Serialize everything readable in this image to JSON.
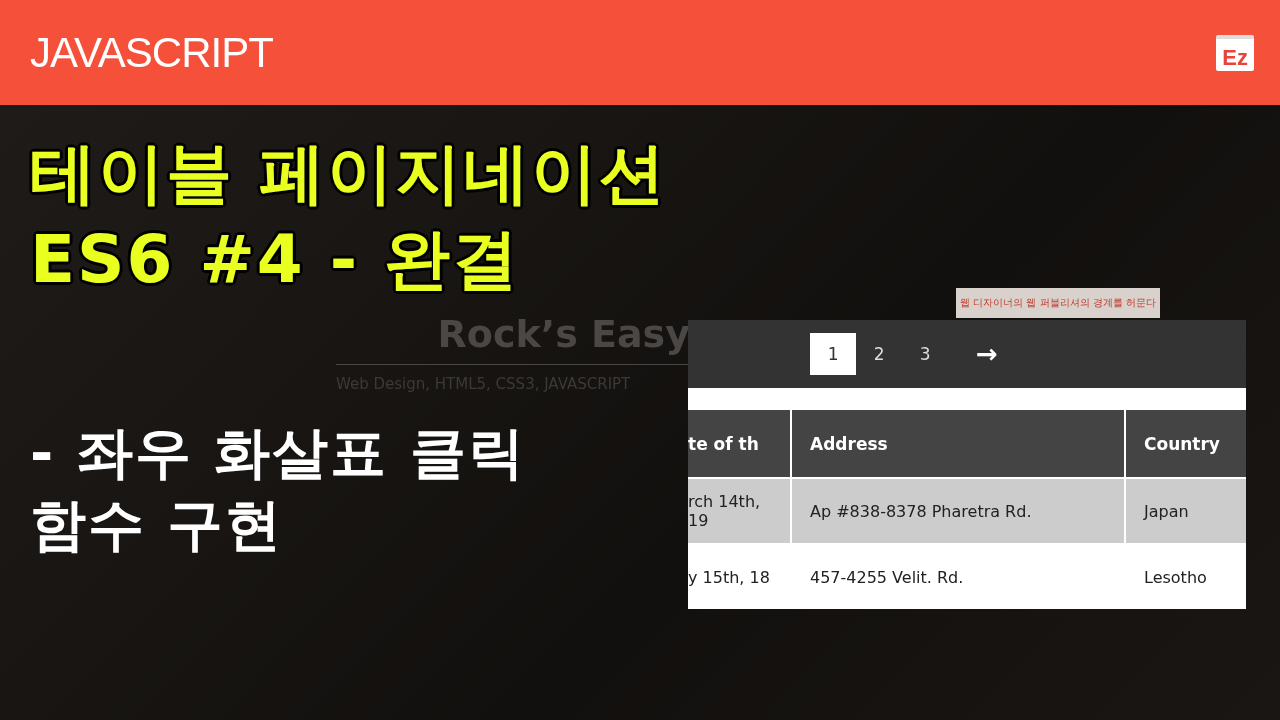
{
  "header": {
    "title": "JAVASCRIPT",
    "logo": "Ez"
  },
  "headline": [
    "테이블 페이지네이션",
    "ES6 #4 - 완결"
  ],
  "subtitle": [
    "- 좌우 화살표 클릭",
    "함수 구현"
  ],
  "background_site": {
    "title": "Rock’s Easy",
    "tagline": "Web Design, HTML5, CSS3, JAVASCRIPT",
    "banner": "웹 디자이너의 웹 퍼블리셔의 경계를 허문다"
  },
  "pagination": {
    "pages": [
      {
        "label": "1",
        "selected": true
      },
      {
        "label": "2",
        "selected": false
      },
      {
        "label": "3",
        "selected": false
      }
    ],
    "next": "→"
  },
  "table": {
    "columns": [
      "te of th",
      "Address",
      "Country"
    ],
    "rows": [
      [
        "rch 14th, 19",
        "Ap #838-8378 Pharetra Rd.",
        "Japan"
      ],
      [
        "y 15th, 18",
        "457-4255 Velit. Rd.",
        "Lesotho"
      ]
    ]
  }
}
